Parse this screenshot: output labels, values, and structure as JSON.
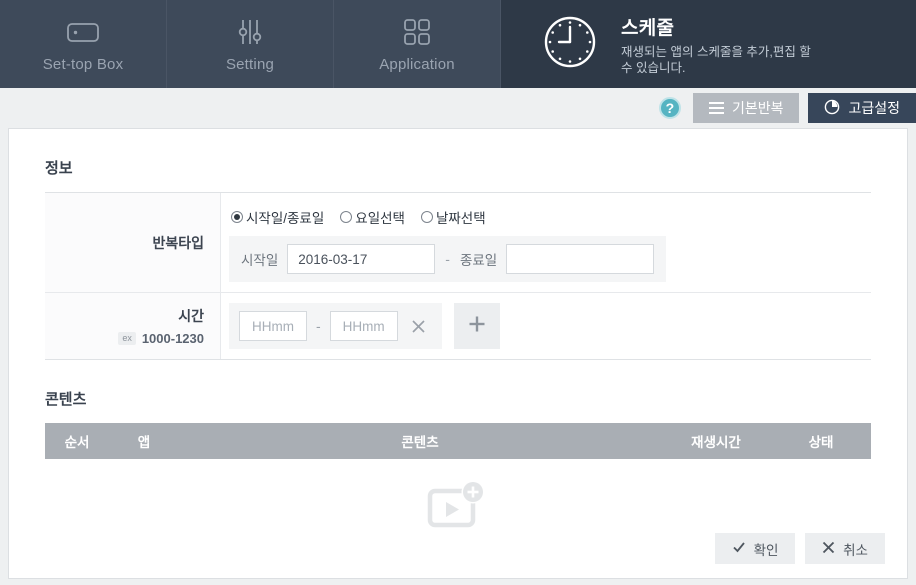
{
  "nav": {
    "tabs": [
      {
        "label": "Set-top Box",
        "icon": "settopbox-icon"
      },
      {
        "label": "Setting",
        "icon": "sliders-icon"
      },
      {
        "label": "Application",
        "icon": "grid-icon"
      }
    ],
    "active": {
      "title": "스케줄",
      "desc": "재생되는 앱의 스케줄을 추가,편집 할 수 있습니다.",
      "icon": "clock-icon"
    },
    "accent_color": "#5cb3bf"
  },
  "toolbar": {
    "help_label": "?",
    "basic_repeat_label": "기본반복",
    "advanced_label": "고급설정"
  },
  "info": {
    "section_title": "정보",
    "repeat_type": {
      "label": "반복타입",
      "options": [
        {
          "label": "시작일/종료일",
          "selected": true
        },
        {
          "label": "요일선택",
          "selected": false
        },
        {
          "label": "날짜선택",
          "selected": false
        }
      ],
      "start_label": "시작일",
      "start_value": "2016-03-17",
      "separator": "-",
      "end_label": "종료일",
      "end_value": "",
      "end_placeholder": ""
    },
    "time": {
      "label": "시간",
      "ex_badge": "ex",
      "ex_value": "1000-1230",
      "from_placeholder": "HHmm",
      "from_value": "",
      "to_placeholder": "HHmm",
      "to_value": "",
      "separator": "-",
      "remove_icon": "close-icon",
      "add_icon": "plus-icon"
    }
  },
  "contents": {
    "section_title": "콘텐츠",
    "columns": [
      "순서",
      "앱",
      "콘텐츠",
      "재생시간",
      "상태"
    ],
    "rows": [],
    "empty_icon": "add-media-icon"
  },
  "footer": {
    "confirm_label": "확인",
    "cancel_label": "취소"
  }
}
